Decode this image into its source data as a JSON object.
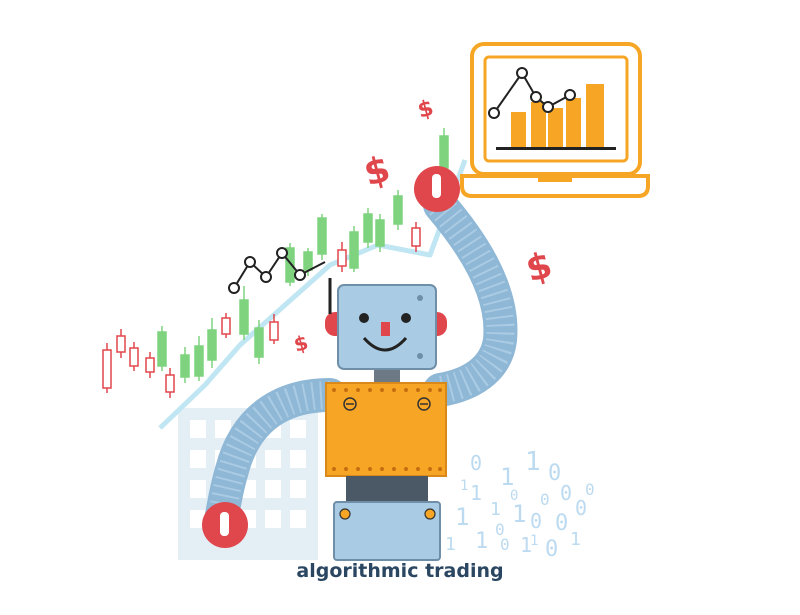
{
  "caption": "algorithmic trading",
  "icons": [
    "dollar-sign-icon",
    "laptop-icon",
    "robot-icon",
    "binary-code-icon",
    "candlestick-chart-icon"
  ],
  "colors": {
    "bull": "#7fd37f",
    "bear": "#e0474c",
    "trend": "#bfe6f2",
    "laptop": "#f6a624",
    "robot_metal": "#a9cbe3",
    "robot_body": "#f6a624",
    "joint": "#e0474c",
    "caption": "#2a4661"
  },
  "binary_text": [
    "0",
    "1",
    "1",
    "0",
    "0",
    "1",
    "1",
    "1",
    "1",
    "0",
    "0",
    "0",
    "1",
    "1",
    "0",
    "1",
    "0",
    "1",
    "0",
    "0",
    "1",
    "0",
    "1",
    "0"
  ]
}
